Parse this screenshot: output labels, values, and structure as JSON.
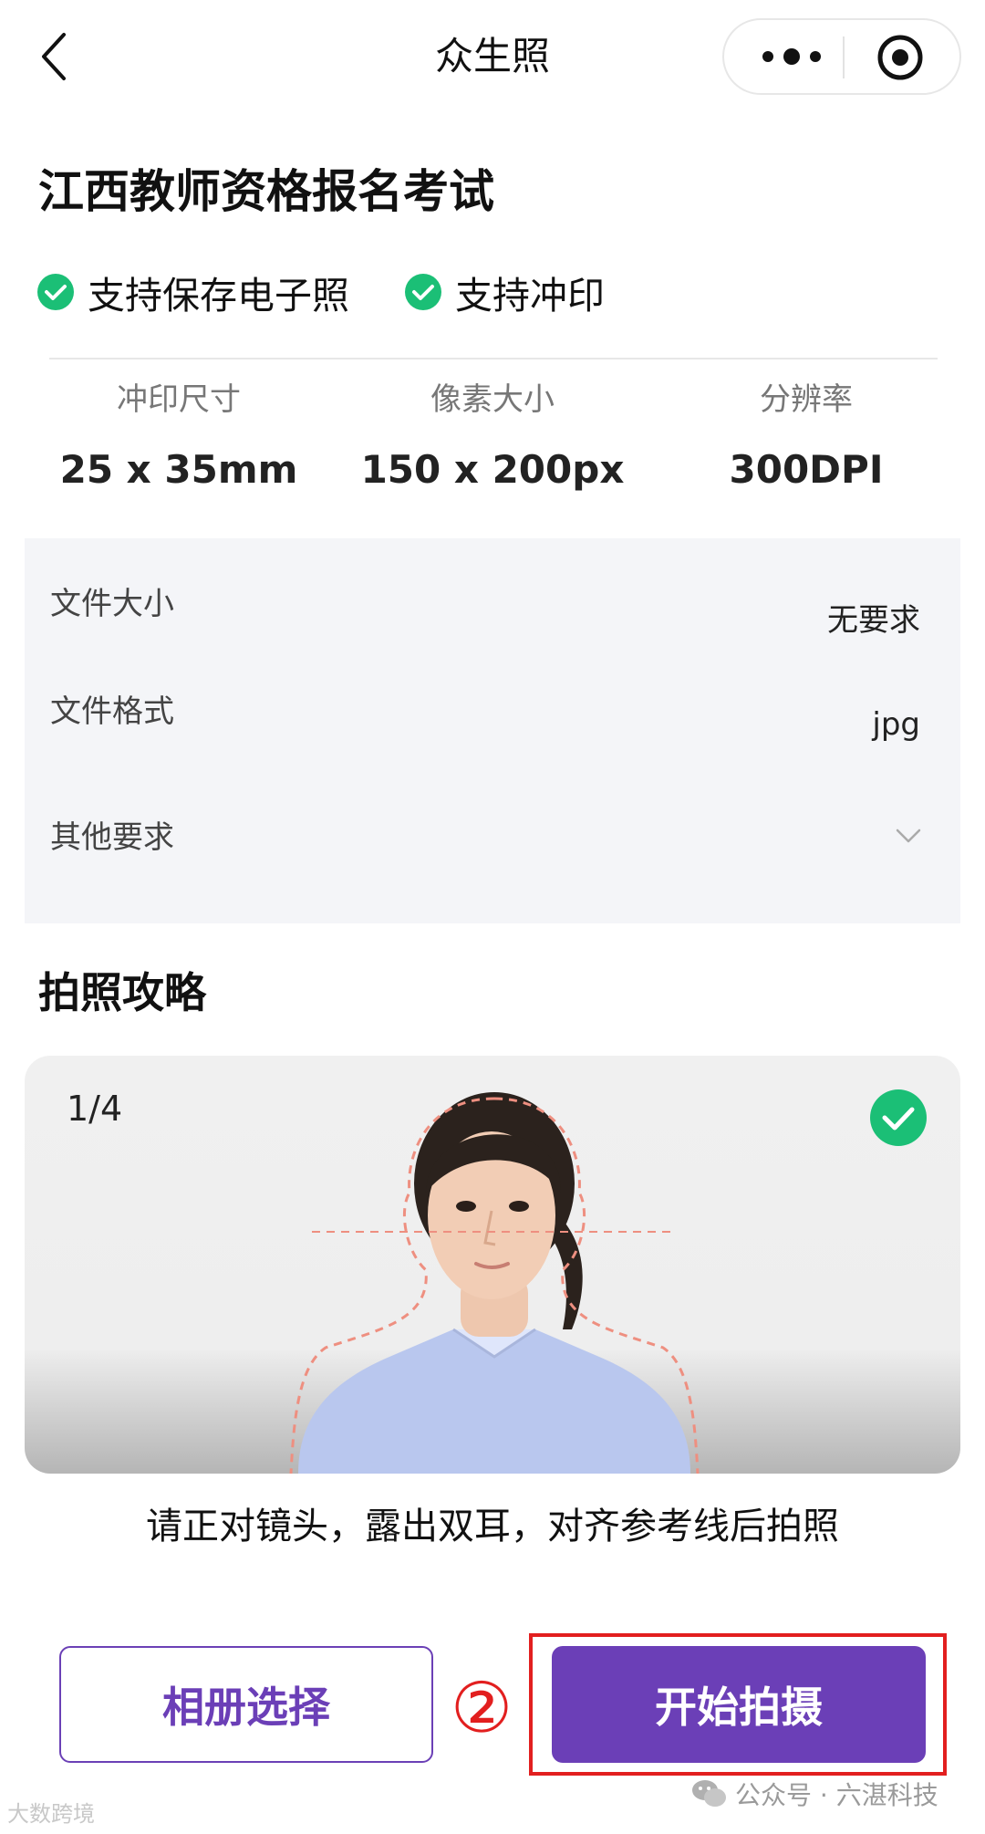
{
  "nav": {
    "title": "众生照"
  },
  "page_title": "江西教师资格报名考试",
  "features": [
    {
      "label": "支持保存电子照"
    },
    {
      "label": "支持冲印"
    }
  ],
  "specs": [
    {
      "label": "冲印尺寸",
      "value": "25 x 35mm"
    },
    {
      "label": "像素大小",
      "value": "150 x 200px"
    },
    {
      "label": "分辨率",
      "value": "300DPI"
    }
  ],
  "info": {
    "file_size": {
      "label": "文件大小",
      "value": "无要求"
    },
    "file_format": {
      "label": "文件格式",
      "value": "jpg"
    },
    "other": {
      "label": "其他要求"
    }
  },
  "guide": {
    "title": "拍照攻略",
    "counter": "1/4",
    "hint": "请正对镜头，露出双耳，对齐参考线后拍照"
  },
  "actions": {
    "album_label": "相册选择",
    "shoot_label": "开始拍摄",
    "step_marker": "②"
  },
  "watermarks": {
    "right": "公众号 · 六湛科技",
    "left": "大数跨境"
  },
  "colors": {
    "accent": "#6b3fb7",
    "check_green": "#1bbf76",
    "highlight_red": "#e21f1f"
  }
}
